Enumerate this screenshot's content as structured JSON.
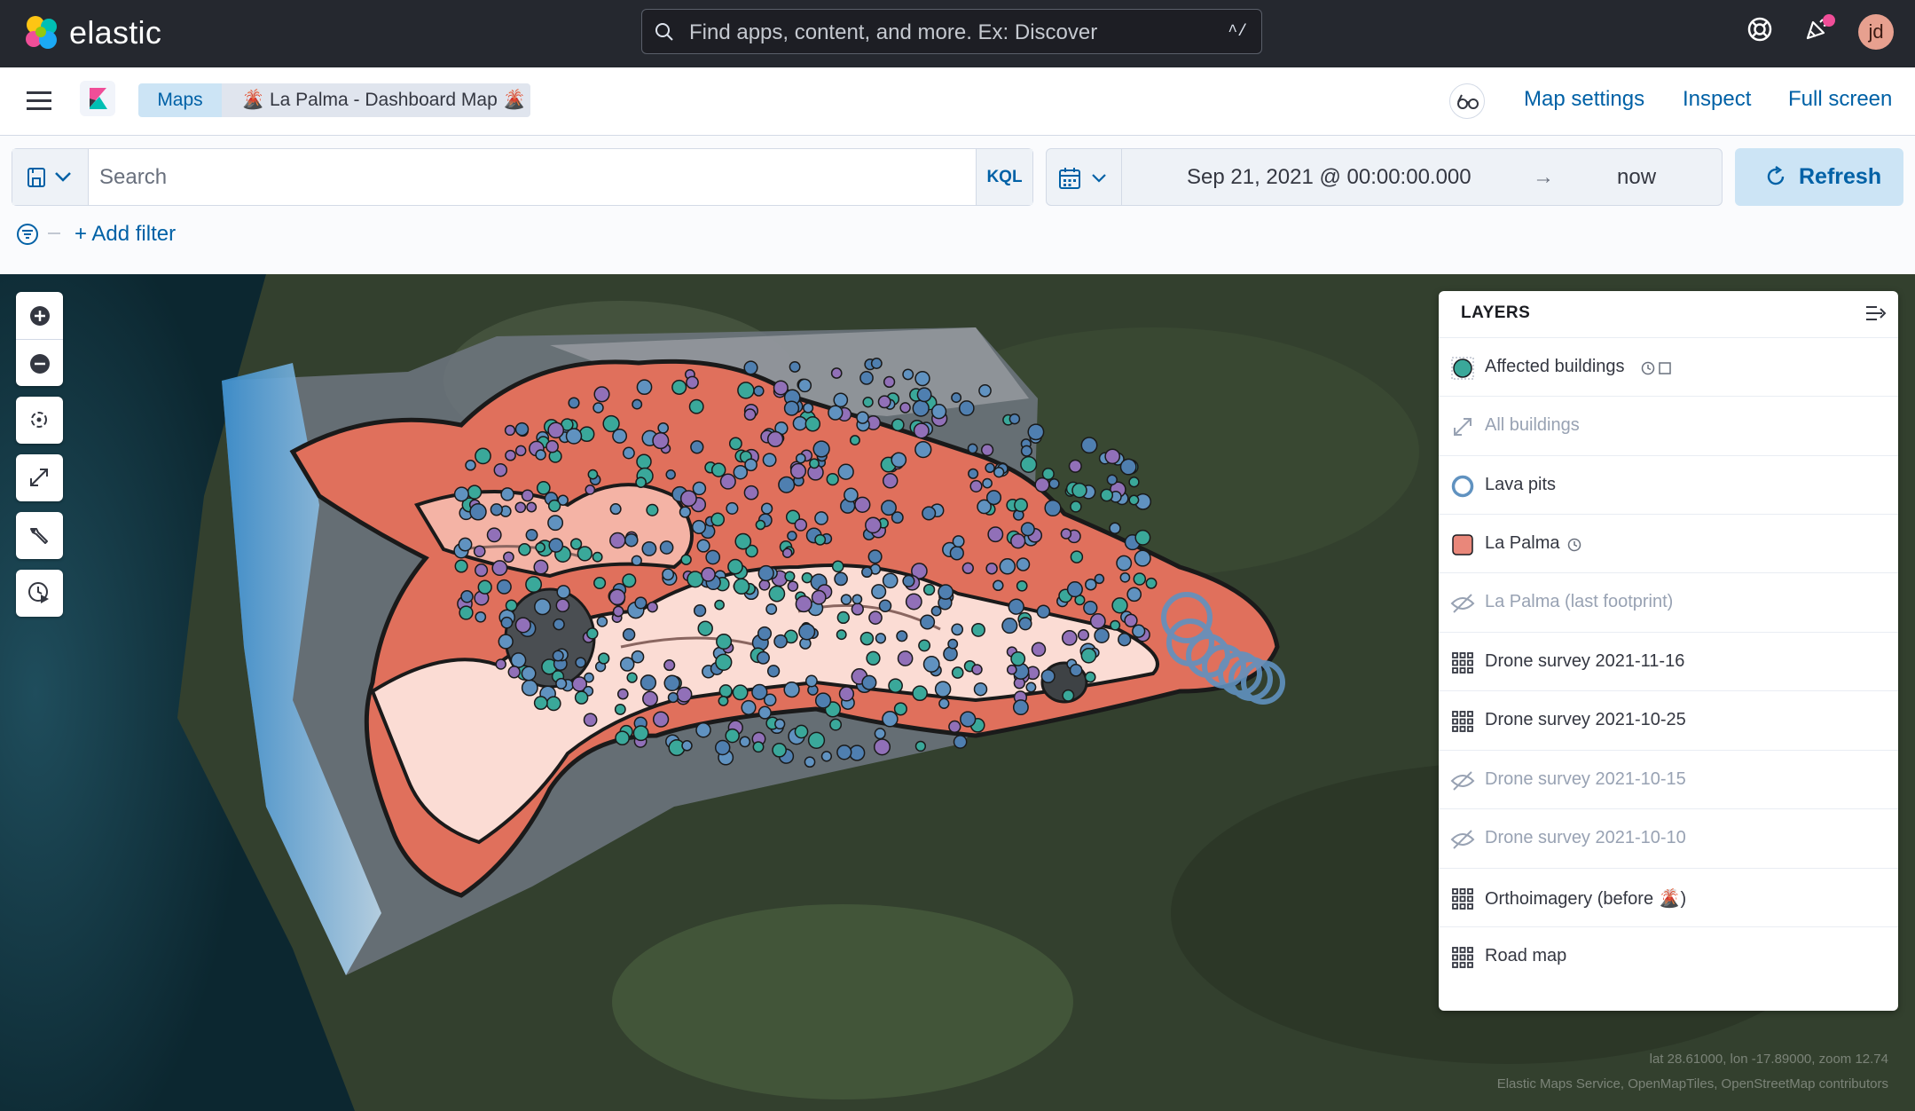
{
  "app": {
    "brand": "elastic"
  },
  "global_search": {
    "placeholder": "Find apps, content, and more. Ex: Discover",
    "shortcut": "^/"
  },
  "user": {
    "initials": "jd"
  },
  "breadcrumbs": [
    {
      "label": "Maps"
    },
    {
      "label": "🌋 La Palma - Dashboard Map 🌋"
    }
  ],
  "header_links": {
    "map_settings": "Map settings",
    "inspect": "Inspect",
    "full_screen": "Full screen"
  },
  "query": {
    "placeholder": "Search",
    "language": "KQL"
  },
  "time": {
    "from": "Sep 21, 2021 @ 00:00:00.000",
    "arrow": "→",
    "to": "now"
  },
  "refresh_label": "Refresh",
  "add_filter_label": "+ Add filter",
  "layers_panel": {
    "title": "LAYERS",
    "items": [
      {
        "name": "Affected buildings",
        "icon": "teal-circle-icon",
        "visible": true
      },
      {
        "name": "All buildings",
        "icon": "resize-icon",
        "visible": false
      },
      {
        "name": "Lava pits",
        "icon": "blue-ring-icon",
        "visible": true
      },
      {
        "name": "La Palma",
        "icon": "salmon-square-icon",
        "visible": true
      },
      {
        "name": "La Palma (last footprint)",
        "icon": "eye-closed-icon",
        "visible": false
      },
      {
        "name": "Drone survey 2021-11-16",
        "icon": "grid-icon",
        "visible": true
      },
      {
        "name": "Drone survey 2021-10-25",
        "icon": "grid-icon",
        "visible": true
      },
      {
        "name": "Drone survey 2021-10-15",
        "icon": "eye-closed-icon",
        "visible": false
      },
      {
        "name": "Drone survey 2021-10-10",
        "icon": "eye-closed-icon",
        "visible": false
      },
      {
        "name": "Orthoimagery (before 🌋)",
        "icon": "grid-icon",
        "visible": true
      },
      {
        "name": "Road map",
        "icon": "grid-icon",
        "visible": true
      }
    ]
  },
  "map_attribution": {
    "coords": "lat 28.61000, lon -17.89000, zoom 12.74",
    "credits": "Elastic Maps Service, OpenMapTiles, OpenStreetMap contributors"
  },
  "colors": {
    "topbar": "#25282f",
    "accent": "#0061a6",
    "lava": "#e0705c",
    "lava_light": "#fbdcd4",
    "buildings": "#3aa89a",
    "pits": "#6092c0"
  }
}
